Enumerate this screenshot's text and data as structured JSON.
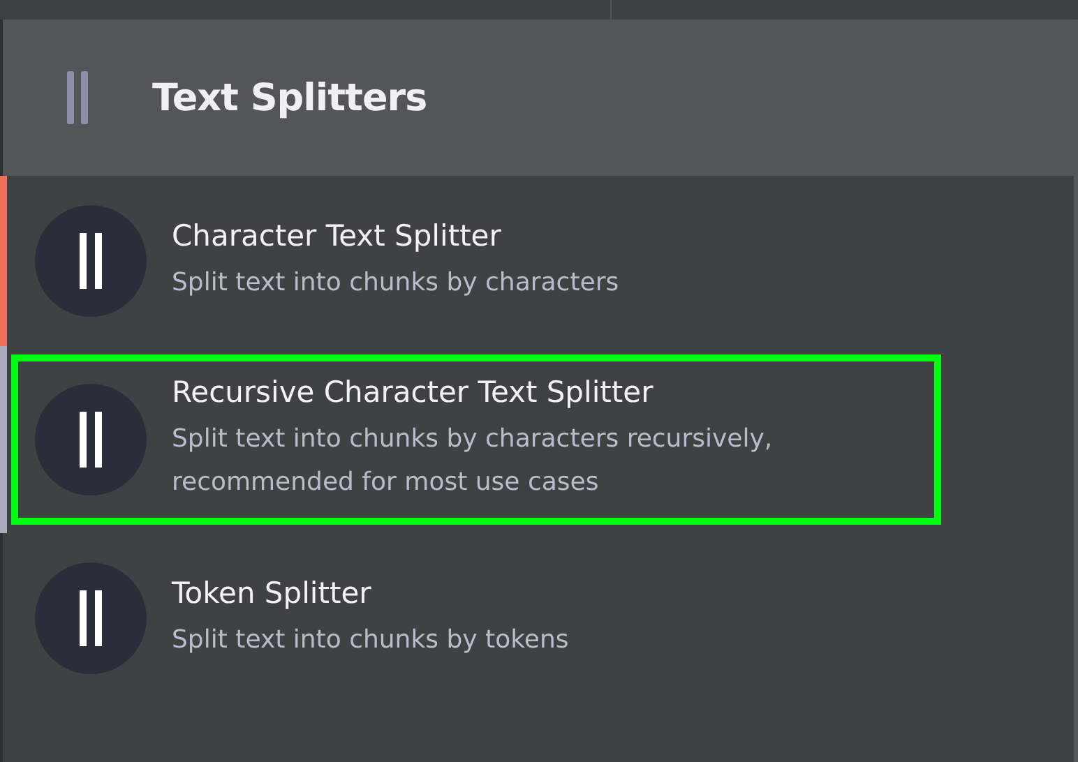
{
  "header": {
    "title": "Text Splitters"
  },
  "items": [
    {
      "title": "Character Text Splitter",
      "description": "Split text into chunks by characters",
      "selected": true,
      "hovered": false,
      "outlined": false
    },
    {
      "title": "Recursive Character Text Splitter",
      "description": "Split text into chunks by characters recursively, recommended for most use cases",
      "selected": false,
      "hovered": true,
      "outlined": true
    },
    {
      "title": "Token Splitter",
      "description": "Split text into chunks by tokens",
      "selected": false,
      "hovered": false,
      "outlined": false
    }
  ]
}
